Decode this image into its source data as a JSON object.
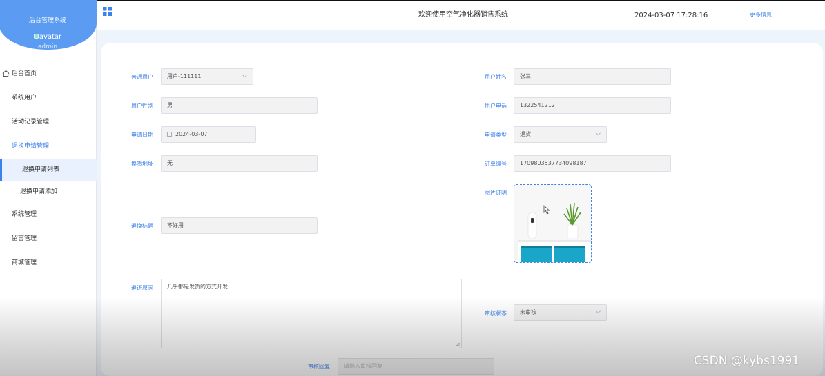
{
  "sidebar": {
    "system_title": "后台管理系统",
    "avatar_alt": "avatar",
    "username": "admin",
    "menu": {
      "home": "后台首页",
      "system_users": "系统用户",
      "activity_records": "活动记录管理",
      "return_requests": "退换申请管理",
      "return_request_list": "退换申请列表",
      "return_request_add": "退换申请添加",
      "system_management": "系统管理",
      "message_management": "留言管理",
      "mall_management": "商城管理"
    }
  },
  "header": {
    "welcome": "欢迎使用空气净化器销售系统",
    "datetime": "2024-03-07 17:28:16",
    "more_info": "更多信息"
  },
  "form": {
    "regular_user": {
      "label": "普通用户",
      "value": "用户-111111"
    },
    "user_name": {
      "label": "用户姓名",
      "value": "张三"
    },
    "user_gender": {
      "label": "用户性别",
      "value": "男"
    },
    "user_phone": {
      "label": "用户电话",
      "value": "1322541212"
    },
    "apply_date": {
      "label": "申请日期",
      "value": "2024-03-07"
    },
    "apply_type": {
      "label": "申请类型",
      "value": "退货"
    },
    "exchange_address": {
      "label": "换货地址",
      "value": "无"
    },
    "order_number": {
      "label": "订单编号",
      "value": "1709803537734098187"
    },
    "image_proof": {
      "label": "图片证明"
    },
    "return_title": {
      "label": "退换标题",
      "value": "不好用"
    },
    "return_reason": {
      "label": "退还原因",
      "value": "几乎都是发货的方式开发"
    },
    "review_status": {
      "label": "审核状态",
      "value": "未审核"
    },
    "review_reply": {
      "label": "审核回复",
      "placeholder": "请输入审核回复"
    }
  },
  "watermark": "CSDN @kybs1991",
  "colors": {
    "accent": "#3d82e8",
    "sidebar_header": "#5b9cf2",
    "main_bg": "#eef4fc"
  }
}
